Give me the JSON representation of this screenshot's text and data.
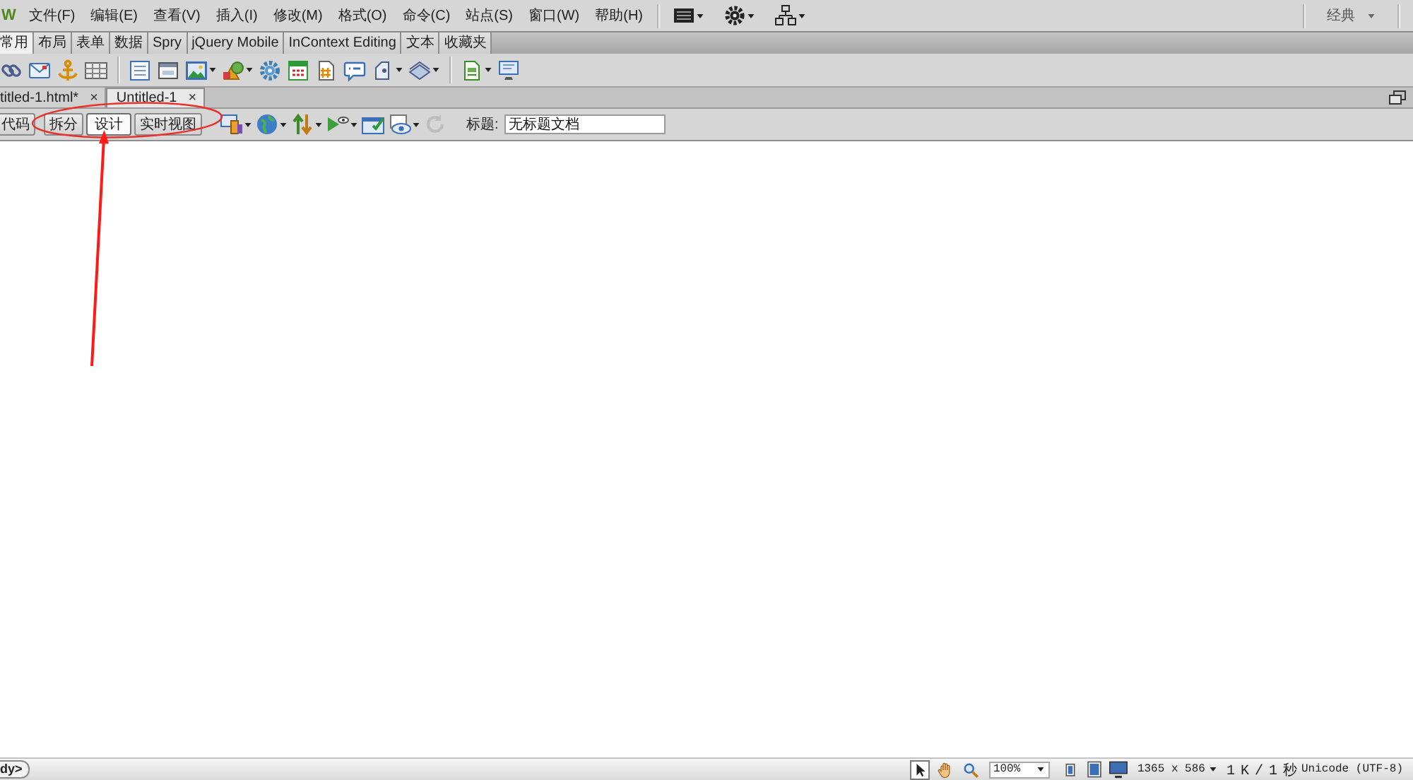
{
  "menu_bar": {
    "logo": "W",
    "items": [
      "文件(F)",
      "编辑(E)",
      "查看(V)",
      "插入(I)",
      "修改(M)",
      "格式(O)",
      "命令(C)",
      "站点(S)",
      "窗口(W)",
      "帮助(H)"
    ],
    "workspace": "经典"
  },
  "insert_panel": {
    "tabs": [
      {
        "label": "常用",
        "selected": true
      },
      {
        "label": "布局",
        "selected": false
      },
      {
        "label": "表单",
        "selected": false
      },
      {
        "label": "数据",
        "selected": false
      },
      {
        "label": "Spry",
        "selected": false
      },
      {
        "label": "jQuery Mobile",
        "selected": false
      },
      {
        "label": "InContext Editing",
        "selected": false
      },
      {
        "label": "文本",
        "selected": false
      },
      {
        "label": "收藏夹",
        "selected": false
      }
    ]
  },
  "document_tabs": [
    {
      "label": "titled-1.html*",
      "close": "×",
      "selected": false
    },
    {
      "label": "Untitled-1",
      "close": "×",
      "selected": true
    }
  ],
  "document_toolbar": {
    "views": [
      {
        "label": "代码",
        "selected": false
      },
      {
        "label": "拆分",
        "selected": false
      },
      {
        "label": "设计",
        "selected": true
      },
      {
        "label": "实时视图",
        "selected": false
      }
    ],
    "refresh": {
      "disabled": true
    },
    "title_label": "标题:",
    "title_value": "无标题文档"
  },
  "status_bar": {
    "tag": "dy>",
    "tools": [
      {
        "kind": "pointer",
        "selected": true
      },
      {
        "kind": "hand",
        "selected": false
      },
      {
        "kind": "zoom",
        "selected": false
      }
    ],
    "zoom": "100%",
    "window_size": "1365 x 586",
    "download": "1 K / 1 秒",
    "encoding": "Unicode (UTF-8)"
  }
}
